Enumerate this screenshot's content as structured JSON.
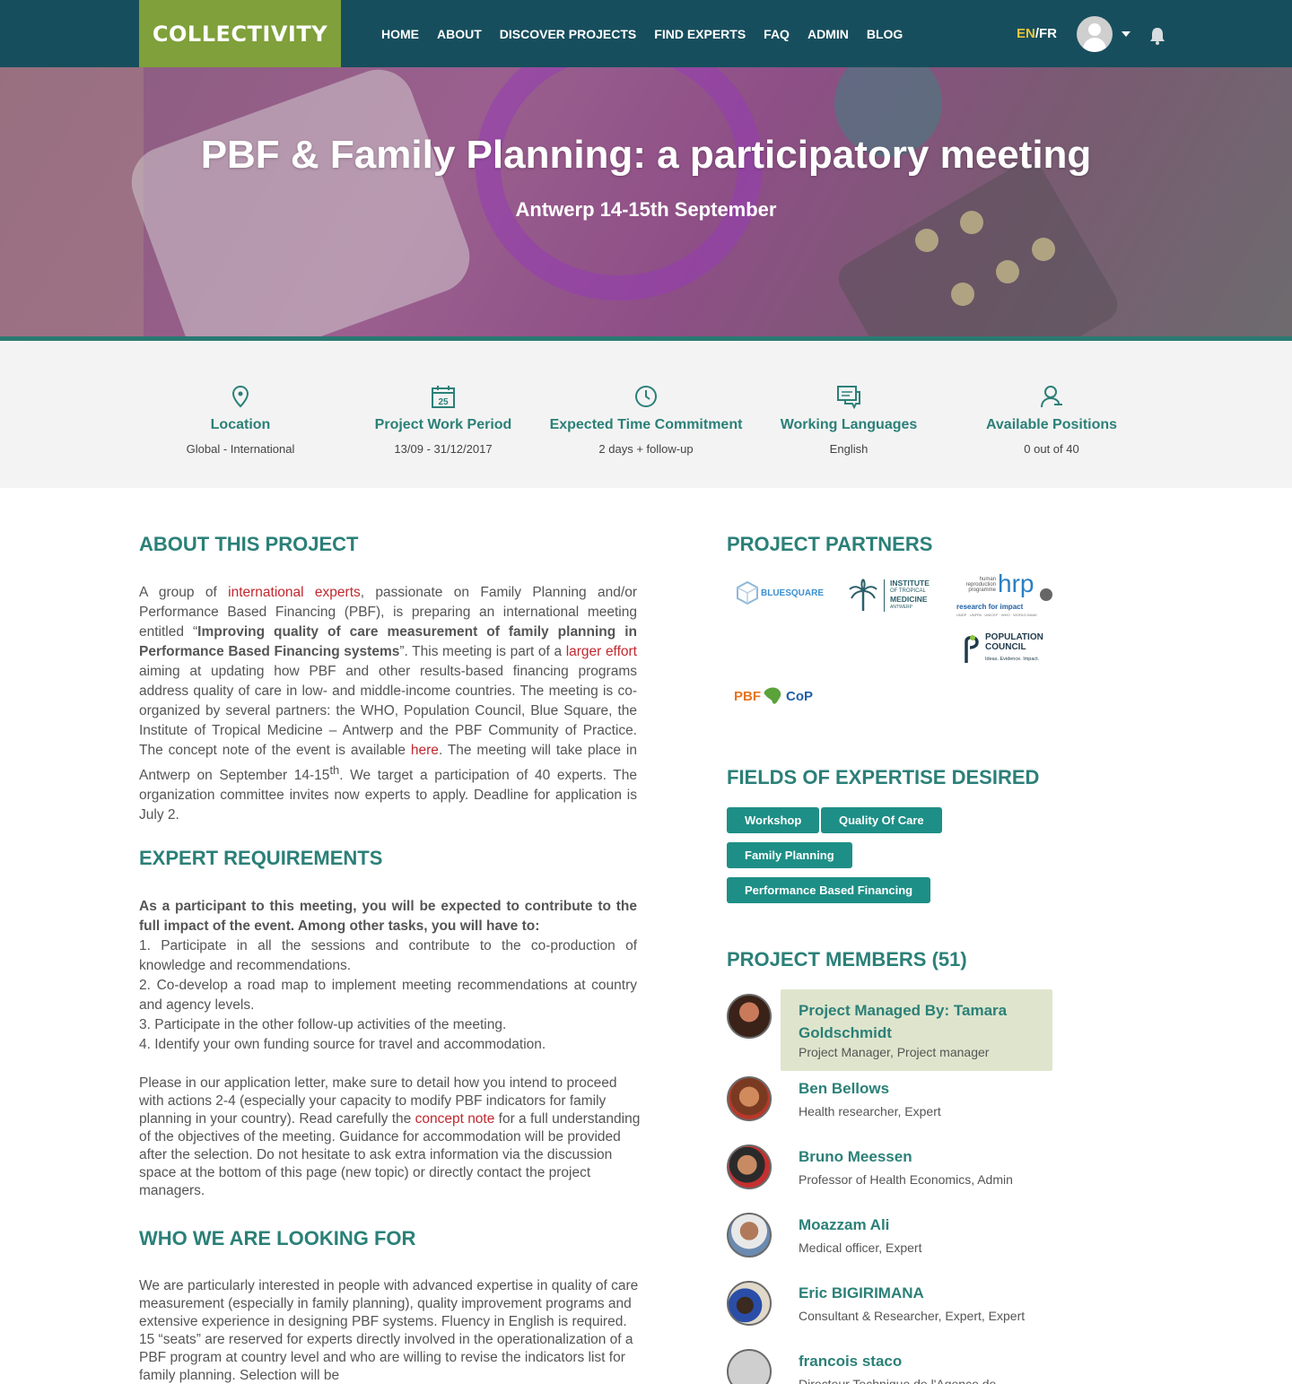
{
  "nav": {
    "logo": "COLLECTIVITY",
    "items": [
      "HOME",
      "ABOUT",
      "DISCOVER PROJECTS",
      "FIND EXPERTS",
      "FAQ",
      "ADMIN",
      "BLOG"
    ],
    "lang_en": "EN",
    "lang_sep": "/",
    "lang_fr": "FR"
  },
  "hero": {
    "title": "PBF & Family Planning: a participatory meeting",
    "subtitle": "Antwerp 14-15th September"
  },
  "info": [
    {
      "icon": "location-pin-icon",
      "label": "Location",
      "value": "Global - International"
    },
    {
      "icon": "calendar-icon",
      "label": "Project Work Period",
      "value": "13/09 - 31/12/2017",
      "calendar_day": "25"
    },
    {
      "icon": "clock-icon",
      "label": "Expected Time Commitment",
      "value": "2 days + follow-up"
    },
    {
      "icon": "chat-icon",
      "label": "Working Languages",
      "value": "English"
    },
    {
      "icon": "user-icon",
      "label": "Available Positions",
      "value": "0 out of 40"
    }
  ],
  "about": {
    "heading": "ABOUT THIS PROJECT",
    "t1": "A group of ",
    "l1": "international experts",
    "t2": ", passionate on Family Planning and/or Performance Based Financing (PBF), is preparing an international meeting entitled “",
    "b1": "Improving quality of care measurement of family planning in Performance Based Financing systems",
    "t3": "”. This meeting is part of a ",
    "l2": "larger effort",
    "t4": " aiming at updating how PBF and other results-based financing programs address quality of care in low- and middle-income countries. The meeting is co-organized by several partners: the WHO, Population Council, Blue Square, the Institute of Tropical Medicine – Antwerp and the PBF Community of Practice. The concept note of the event is available ",
    "l3": "here",
    "t5": ". The meeting will take place in Antwerp on September 14-15",
    "sup": "th",
    "t6": ". We target a participation of 40 experts. The organization committee invites now experts to apply. Deadline for application is July 2."
  },
  "requirements": {
    "heading": "EXPERT REQUIREMENTS",
    "intro": "As a participant to this meeting, you will be expected to contribute to the full impact of the event. Among other tasks, you will have to:",
    "items": [
      "1. Participate in all the sessions and contribute to the co-production of knowledge and recommendations.",
      "2. Co-develop a road map to implement meeting recommendations at country and agency levels.",
      "3. Participate in the other follow-up activities of the meeting.",
      "4. Identify your own funding source for travel and accommodation."
    ],
    "p2a": "Please in our application letter, make sure to detail how you intend to proceed with actions 2-4 (especially your capacity to modify PBF indicators for family planning in your country). Read carefully the ",
    "p2link": "concept note",
    "p2b": " for a full understanding of the objectives of the meeting. Guidance for accommodation will be provided after the selection. Do not hesitate to ask extra information via the discussion space at the bottom of this page (new topic) or directly contact the project managers."
  },
  "looking": {
    "heading": "WHO WE ARE LOOKING FOR",
    "text": "We are particularly interested in people with advanced expertise in quality of care measurement (especially in family planning), quality improvement programs and extensive experience in designing PBF systems. Fluency in English is required. 15 “seats” are reserved for experts directly involved in the operationalization of a PBF program at country level and who are willing  to revise the indicators list for family planning. Selection will be"
  },
  "partners": {
    "heading": "PROJECT PARTNERS",
    "bluesquare": "BLUESQUARE",
    "itm": [
      "INSTITUTE",
      "OF TROPICAL",
      "MEDICINE",
      "ANTWERP"
    ],
    "hrp_small": [
      "human",
      "reproduction",
      "programme"
    ],
    "hrp_big": "hrp",
    "hrp_tag": "research for impact",
    "hrp_orgs": "UNDP · UNFPA · UNICEF · WHO · WORLD BANK",
    "pc_name": [
      "POPULATION",
      "COUNCIL"
    ],
    "pc_tag": "Ideas. Evidence. Impact.",
    "pbf_a": "PBF",
    "pbf_b": "CoP"
  },
  "fields": {
    "heading": "FIELDS OF EXPERTISE DESIRED",
    "tags": [
      "Workshop",
      "Quality Of Care",
      "Family Planning",
      "Performance Based Financing"
    ]
  },
  "members": {
    "heading": "PROJECT MEMBERS (51)",
    "manager_name": "Project Managed By: Tamara Goldschmidt",
    "manager_role": "Project Manager, Project manager",
    "list": [
      {
        "name": "Ben Bellows",
        "role": "Health researcher, Expert"
      },
      {
        "name": "Bruno Meessen",
        "role": "Professor of Health Economics, Admin"
      },
      {
        "name": "Moazzam Ali",
        "role": "Medical officer, Expert"
      },
      {
        "name": "Eric BIGIRIMANA",
        "role": "Consultant & Researcher, Expert, Expert"
      },
      {
        "name": "francois staco",
        "role": "Directeur Technique de l'Agence de"
      }
    ]
  },
  "colors": {
    "nav_bg": "#174e5d",
    "logo_bg": "#7fa03a",
    "accent_teal": "#2b8078",
    "tag_bg": "#1e8f86",
    "link_red": "#c0282f",
    "lang_active": "#e7c53a",
    "manager_bg": "#dfe5cd"
  }
}
